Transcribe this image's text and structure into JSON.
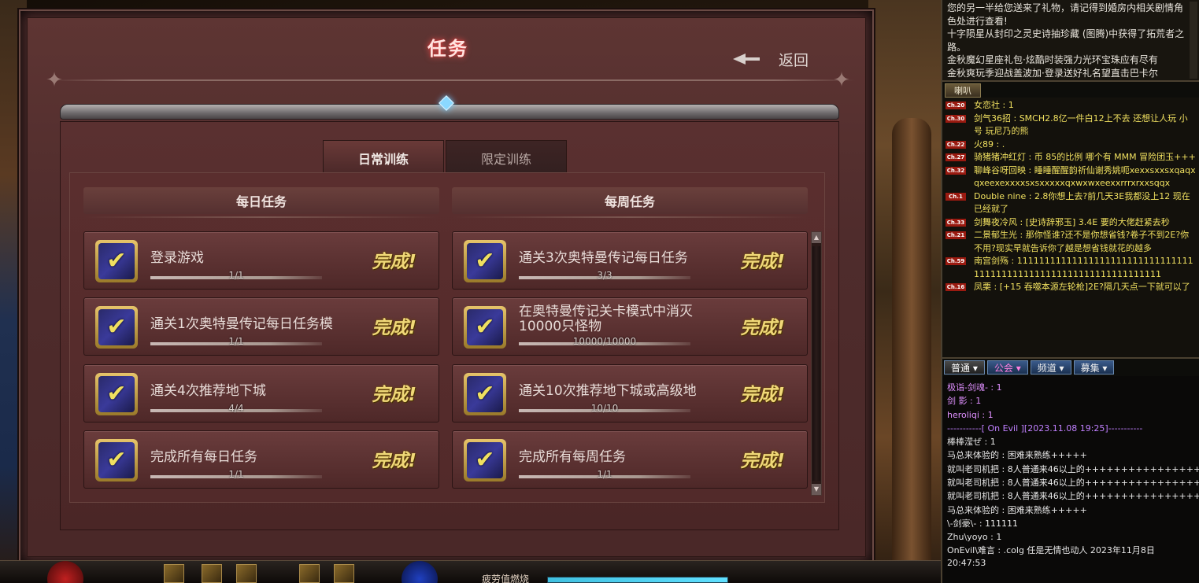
{
  "panel": {
    "title": "任务",
    "back_label": "返回"
  },
  "tabs": [
    {
      "label": "日常训练",
      "active": true
    },
    {
      "label": "限定训练",
      "active": false
    }
  ],
  "daily": {
    "header": "每日任务",
    "tasks": [
      {
        "name": "登录游戏",
        "progress": "1/1",
        "status": "完成!",
        "icon": "login-reward-icon"
      },
      {
        "name": "通关1次奥特曼传记每日任务模",
        "progress": "1/1",
        "status": "完成!",
        "icon": "checkmark-reward-icon"
      },
      {
        "name": "通关4次推荐地下城",
        "progress": "4/4",
        "status": "完成!",
        "icon": "checkmark-reward-icon"
      },
      {
        "name": "完成所有每日任务",
        "progress": "1/1",
        "status": "完成!",
        "icon": "checkmark-reward-icon"
      }
    ]
  },
  "weekly": {
    "header": "每周任务",
    "tasks": [
      {
        "name": "通关3次奥特曼传记每日任务",
        "progress": "3/3",
        "status": "完成!",
        "icon": "checkmark-reward-icon"
      },
      {
        "name": "在奥特曼传记关卡模式中消灭10000只怪物",
        "progress": "10000/10000",
        "status": "完成!",
        "icon": "checkmark-reward-icon"
      },
      {
        "name": "通关10次推荐地下城或高级地",
        "progress": "10/10",
        "status": "完成!",
        "icon": "checkmark-reward-icon"
      },
      {
        "name": "完成所有每周任务",
        "progress": "1/1",
        "status": "完成!",
        "icon": "checkmark-reward-icon"
      }
    ]
  },
  "hud": {
    "fatigue_label": "疲劳值燃烧"
  },
  "chat": {
    "system_lines": [
      "您的另一半给您送来了礼物，请记得到婚房内相关剧情角",
      "色处进行查看!",
      "十字陨星从封印之灵史诗抽珍藏 (图腾)中获得了拓荒者之",
      "路。",
      "金秋魔幻星座礼包·炫酷时装强力光环宝珠应有尽有",
      "金秋爽玩季迎战盖波加·登录送好礼名望直击巴卡尔"
    ],
    "speaker_tab": "喇叭",
    "world_lines": [
      {
        "lv": "Ch.20",
        "text": "女恋社 : 1"
      },
      {
        "lv": "Ch.30",
        "text": "剑气36招 : SMCH2.8亿一件白12上不去 还想让人玩 小号 玩尼乃的熊"
      },
      {
        "lv": "Ch.22",
        "text": "火89 : ."
      },
      {
        "lv": "Ch.27",
        "text": "骑猪猪冲红灯 : 币   85的比例   哪个有 MMM 冒险团玉+++"
      },
      {
        "lv": "Ch.32",
        "text": "聊峰谷呀回映 : 睡睡醒醒韵祈仙谢秀姚呃xexxsxxsxqaqxqxeexexxxxsxsxxxxxqxwxwxeexxrrrxrxxsqqx"
      },
      {
        "lv": "Ch.1",
        "text": "Double nine : 2.8你想上去?前几天3E我都没上12 现在已经就了"
      },
      {
        "lv": "Ch.33",
        "text": "剑舞夜冷风 : [史诗辞邪玉] 3.4E 要的大佬赶紧去秒"
      },
      {
        "lv": "Ch.21",
        "text": "二景郁生光 : 那你怪谁?还不是你想省钱?卷子不到2E?你不用?现实早就告诉你了越是想省钱就花的越多"
      },
      {
        "lv": "Ch.59",
        "text": "南宫剑殇 : 111111111111111111111111111111111111111111111111111111111111111111"
      },
      {
        "lv": "Ch.16",
        "text": "凤栗 : [+15 吞噬本源左轮枪]2E?隔几天点一下就可以了"
      }
    ],
    "channel_tabs": [
      "普通",
      "公会",
      "频道",
      "募集"
    ],
    "chat_lines": [
      {
        "text": "极诣-剑魂- : 1",
        "style": "guild"
      },
      {
        "text": "剑 影 : 1",
        "style": "guild"
      },
      {
        "text": "heroliqi : 1",
        "style": "guild"
      },
      {
        "text": "-----------[ On Evil ][2023.11.08 19:25]-----------",
        "style": "sep"
      },
      {
        "text": "棒棒滢ぜ : 1",
        "style": "normal"
      },
      {
        "text": "马总来体验的 : 困难来熟练+++++",
        "style": "normal"
      },
      {
        "text": "就叫老司机把 : 8人普通来46以上的+++++++++++++++++",
        "style": "normal"
      },
      {
        "text": "就叫老司机把 : 8人普通来46以上的+++++++++++++++++",
        "style": "normal"
      },
      {
        "text": "就叫老司机把 : 8人普通来46以上的+++++++++++++++++",
        "style": "normal"
      },
      {
        "text": "马总来体验的 : 困难来熟练+++++",
        "style": "normal"
      },
      {
        "text": "\\-剑豪\\- : 111111",
        "style": "normal"
      },
      {
        "text": "Zhu\\yoyo : 1",
        "style": "normal"
      },
      {
        "text": "OnEvil\\难言 : .colg  任是无情也动人 2023年11月8日 20:47:53",
        "style": "normal"
      }
    ]
  }
}
